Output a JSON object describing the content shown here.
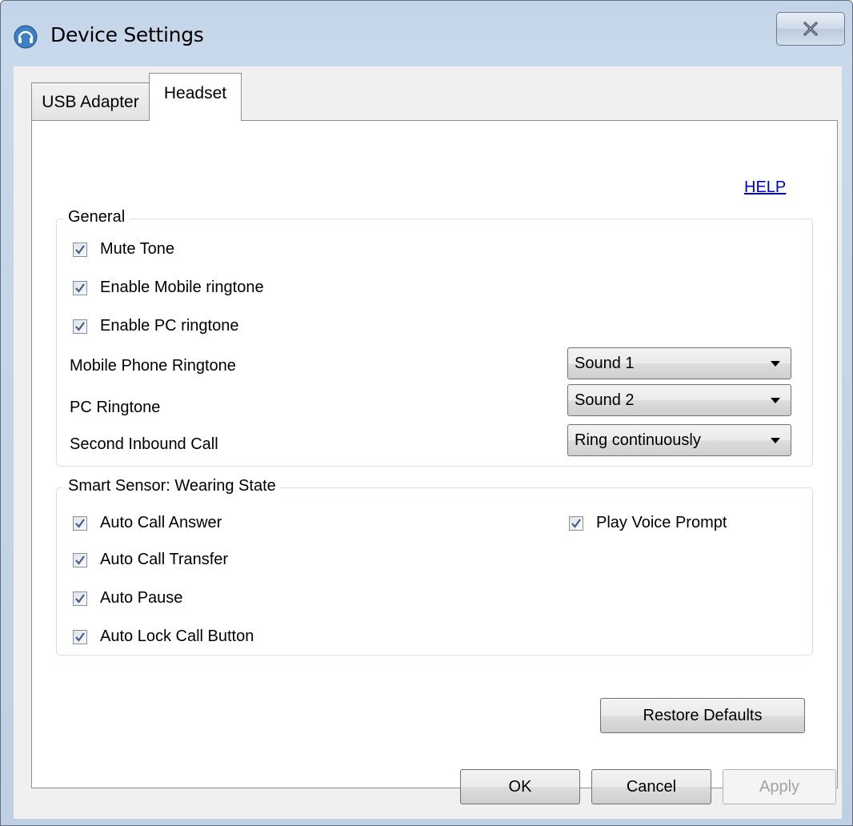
{
  "window": {
    "title": "Device Settings"
  },
  "tabs": [
    {
      "label": "USB Adapter",
      "active": false
    },
    {
      "label": "Headset",
      "active": true
    }
  ],
  "help_link": "HELP",
  "general": {
    "legend": "General",
    "checkboxes": [
      {
        "label": "Mute Tone",
        "checked": true
      },
      {
        "label": "Enable Mobile ringtone",
        "checked": true
      },
      {
        "label": "Enable PC ringtone",
        "checked": true
      }
    ],
    "dropdowns": [
      {
        "label": "Mobile Phone Ringtone",
        "value": "Sound 1"
      },
      {
        "label": "PC Ringtone",
        "value": "Sound 2"
      },
      {
        "label": "Second Inbound Call",
        "value": "Ring continuously"
      }
    ]
  },
  "smart_sensor": {
    "legend": "Smart Sensor: Wearing State",
    "checkboxes": [
      {
        "label": "Auto Call Answer",
        "checked": true
      },
      {
        "label": "Auto Call Transfer",
        "checked": true
      },
      {
        "label": "Auto Pause",
        "checked": true
      },
      {
        "label": "Auto Lock Call Button",
        "checked": true
      },
      {
        "label": "Play Voice Prompt",
        "checked": true
      }
    ]
  },
  "buttons": {
    "restore_defaults": "Restore Defaults",
    "ok": "OK",
    "cancel": "Cancel",
    "apply": "Apply"
  },
  "icons": {
    "app": "headset-icon",
    "close": "close-icon",
    "check": "checkmark-icon",
    "dropdown": "chevron-down-icon"
  }
}
